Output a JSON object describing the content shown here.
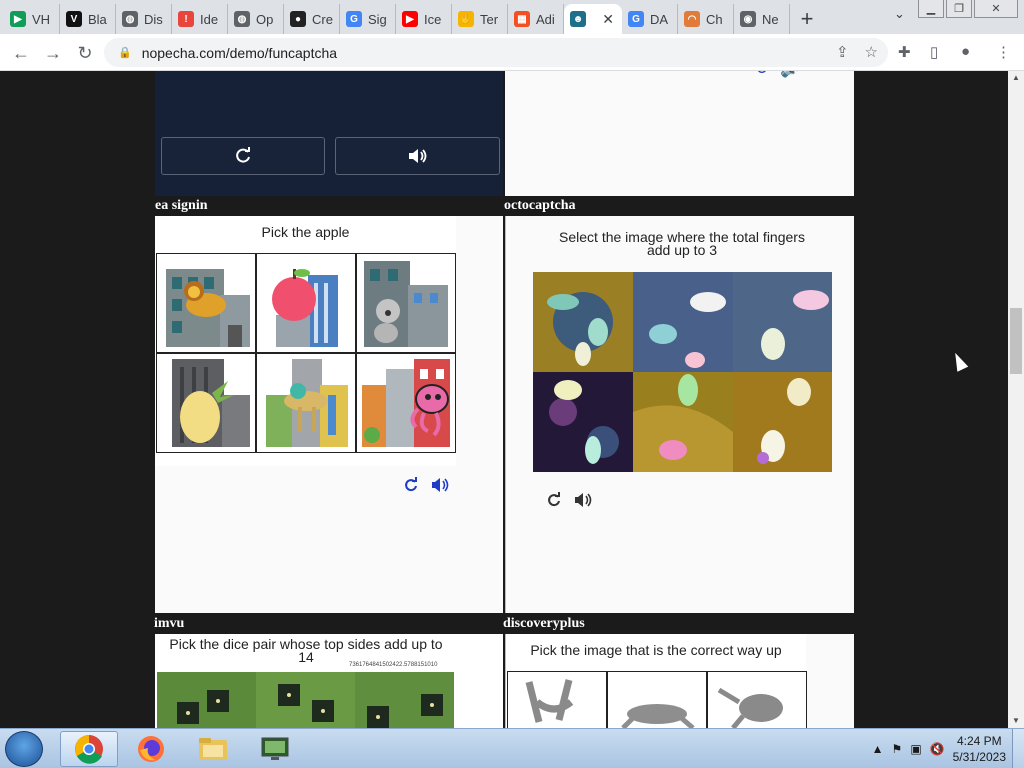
{
  "browser": {
    "tabs": [
      {
        "label": "VH",
        "icon": "play-store-icon",
        "color": "#0f9d58"
      },
      {
        "label": "Bla",
        "icon": "vimeo-icon",
        "color": "#111111"
      },
      {
        "label": "Dis",
        "icon": "globe-icon",
        "color": "#5f6368"
      },
      {
        "label": "Ide",
        "icon": "ideas-icon",
        "color": "#e8453c"
      },
      {
        "label": "Op",
        "icon": "globe-icon",
        "color": "#5f6368"
      },
      {
        "label": "Cre",
        "icon": "dots-icon",
        "color": "#222222"
      },
      {
        "label": "Sig",
        "icon": "google-icon",
        "color": "#4285f4"
      },
      {
        "label": "Ice",
        "icon": "youtube-icon",
        "color": "#ff0000"
      },
      {
        "label": "Ter",
        "icon": "hand-icon",
        "color": "#f4b400"
      },
      {
        "label": "Adi",
        "icon": "microsoft-icon",
        "color": "#f25022"
      },
      {
        "label": "",
        "icon": "robot-icon",
        "color": "#1f6f8b",
        "active": true
      },
      {
        "label": "DA",
        "icon": "google-icon",
        "color": "#4285f4"
      },
      {
        "label": "Ch",
        "icon": "rainbow-icon",
        "color": "#e07b39"
      },
      {
        "label": "Ne",
        "icon": "chrome-icon",
        "color": "#5f6368"
      }
    ],
    "url": "nopecha.com/demo/funcaptcha"
  },
  "captchas": {
    "ea_signin": {
      "label": "ea signin",
      "prompt": "Pick the apple",
      "tiles": [
        "lion",
        "apple",
        "koala",
        "pineapple",
        "camel",
        "octopus"
      ]
    },
    "octocaptcha": {
      "label": "octocaptcha",
      "prompt": "Select the image where the total fingers add up to 3"
    },
    "imvu": {
      "label": "imvu",
      "prompt": "Pick the dice pair whose top sides add up to 14",
      "token": "7361764841502422.5788151010"
    },
    "discoveryplus": {
      "label": "discoveryplus",
      "prompt": "Pick the image that is the correct way up"
    }
  },
  "taskbar": {
    "time": "4:24 PM",
    "date": "5/31/2023"
  },
  "colors": {
    "accent_blue": "#1e3cc8",
    "dark_panel": "#162036"
  }
}
